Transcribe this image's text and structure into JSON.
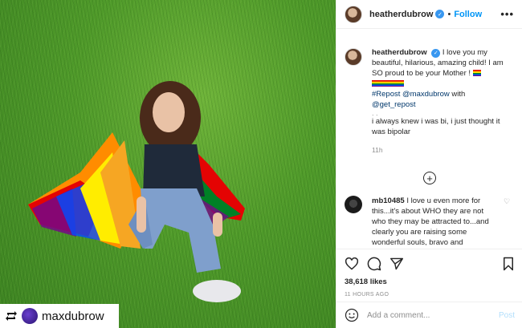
{
  "header": {
    "username": "heatherdubrow",
    "separator": "•",
    "follow_label": "Follow",
    "more_label": "•••"
  },
  "caption": {
    "username": "heatherdubrow",
    "text": "I love you my beautiful, hilarious, amazing child! I am SO proud to be your Mother !",
    "repost_tag": "#Repost",
    "repost_user": "@maxdubrow",
    "with_word": "with",
    "get_repost": "@get_repost",
    "dots": ". .",
    "quote": "i always knew i was bi, i just thought it was bipolar",
    "time": "11h"
  },
  "comment": {
    "username": "mb10485",
    "text": "I love u even more for this...it's about WHO they are not who they may be attracted to...and clearly you are raising some wonderful souls, bravo and"
  },
  "actions": {
    "likes": "38,618 likes",
    "time_ago": "11 HOURS AGO"
  },
  "add_comment": {
    "placeholder": "Add a comment...",
    "post_label": "Post"
  },
  "credit": {
    "username": "maxdubrow"
  },
  "colors": {
    "accent": "#0095f6",
    "verified": "#3897f0",
    "link": "#00376b",
    "post_disabled": "#b2dffc"
  }
}
